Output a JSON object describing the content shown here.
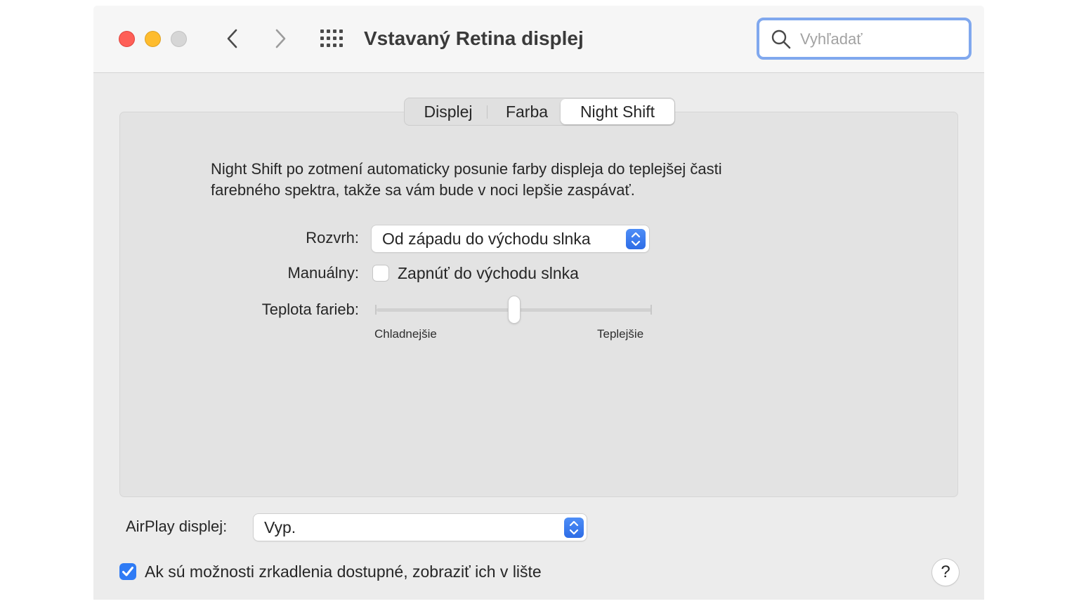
{
  "window": {
    "title": "Vstavaný Retina displej",
    "search": {
      "placeholder": "Vyhľadať",
      "value": ""
    }
  },
  "tabs": [
    {
      "label": "Displej",
      "selected": false
    },
    {
      "label": "Farba",
      "selected": false
    },
    {
      "label": "Night Shift",
      "selected": true
    }
  ],
  "night_shift": {
    "description_line1": "Night Shift po zotmení automaticky posunie farby displeja do teplejšej časti",
    "description_line2": "farebného spektra, takže sa vám bude v noci lepšie zaspávať.",
    "schedule": {
      "label": "Rozvrh:",
      "value": "Od západu do východu slnka"
    },
    "manual": {
      "label": "Manuálny:",
      "checkbox_label": "Zapnúť do východu slnka",
      "checked": false
    },
    "temperature": {
      "label": "Teplota farieb:",
      "min_label": "Chladnejšie",
      "max_label": "Teplejšie",
      "value_fraction": 0.5
    }
  },
  "airplay": {
    "label": "AirPlay displej:",
    "value": "Vyp."
  },
  "mirroring": {
    "label": "Ak sú možnosti zrkadlenia dostupné, zobraziť ich v lište",
    "checked": true
  },
  "help": {
    "label": "?"
  },
  "colors": {
    "accent": "#2f7bf5",
    "close": "#fe5f57",
    "minimize": "#febc2e",
    "zoom_disabled": "#d6d6d6",
    "search_focus_ring": "#80a8ee"
  },
  "icons": [
    "close-icon",
    "minimize-icon",
    "zoom-icon",
    "chevron-left-icon",
    "chevron-right-icon",
    "grid-icon",
    "search-icon",
    "popup-stepper-icon",
    "checkmark-icon"
  ]
}
